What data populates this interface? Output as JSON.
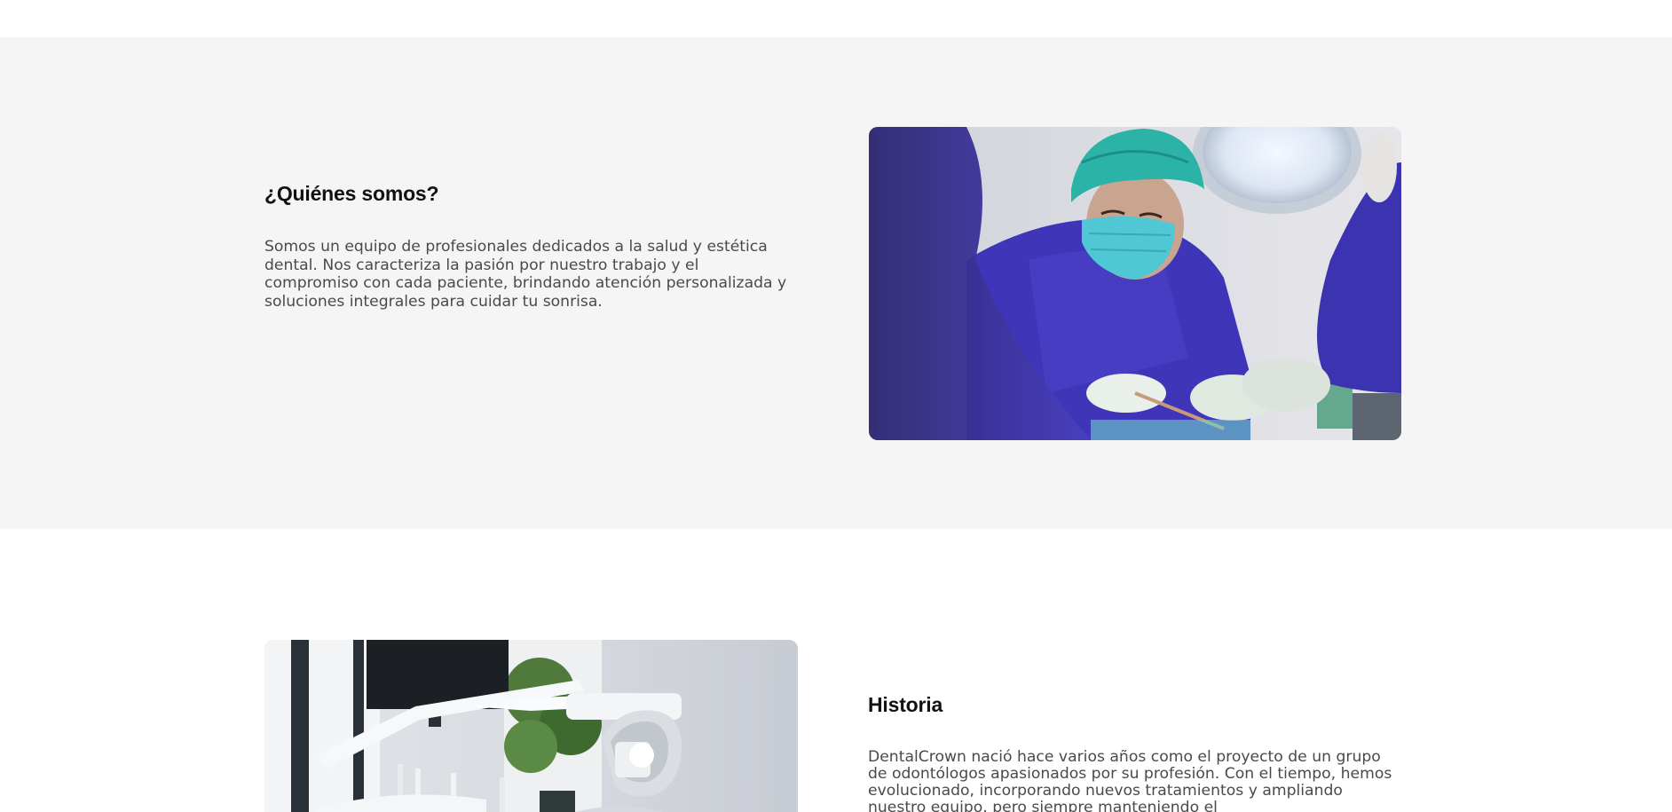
{
  "about": {
    "heading": "¿Quiénes somos?",
    "body": "Somos un equipo de profesionales dedicados a la salud y estética dental. Nos caracteriza la pasión por nuestro trabajo y el compromiso con cada paciente, brindando atención personalizada y soluciones integrales para cuidar tu sonrisa.",
    "image_subject": "surgeon-in-surgical-mask-photo"
  },
  "history": {
    "heading": "Historia",
    "body": "DentalCrown nació hace varios años como el proyecto de un grupo de odontólogos apasionados por su profesión. Con el tiempo, hemos evolucionado, incorporando nuevos tratamientos y ampliando nuestro equipo, pero siempre manteniendo el",
    "image_subject": "dental-chair-clinic-photo"
  },
  "colors": {
    "section_gray": "#f5f5f5",
    "heading": "#111111",
    "body_text": "#4a4a4a",
    "scrubs": "#3f35b8",
    "cap": "#2ab3a6"
  }
}
